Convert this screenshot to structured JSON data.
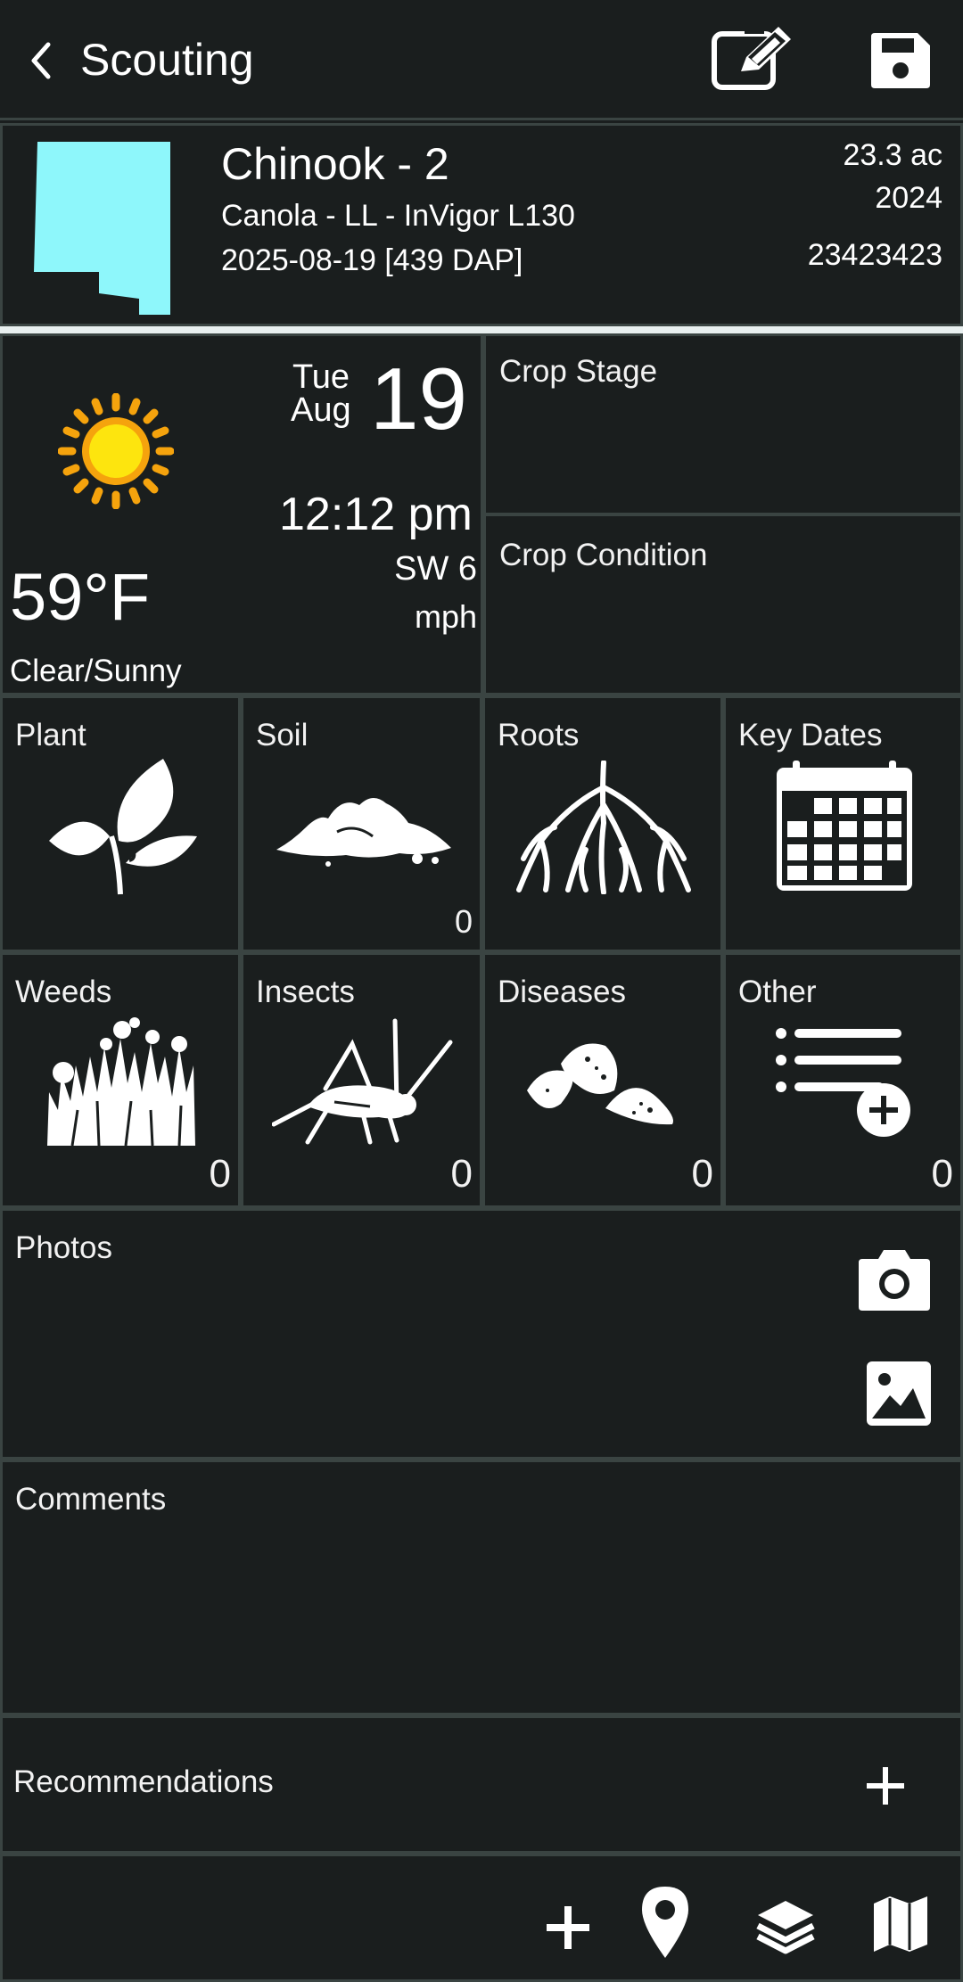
{
  "header": {
    "title": "Scouting",
    "icons": {
      "back": "chevron-left-icon",
      "edit": "edit-icon",
      "save": "save-icon"
    }
  },
  "field": {
    "name": "Chinook - 2",
    "crop": "Canola - LL - InVigor L130",
    "date": "2025-08-19 [439 DAP]",
    "area": "23.3 ac",
    "year": "2024",
    "code": "23423423",
    "shape_color": "#8ef7fb"
  },
  "weather": {
    "weekday": "Tue",
    "month": "Aug",
    "day": "19",
    "time": "12:12 pm",
    "wind_dir": "SW 6",
    "wind_unit": "mph",
    "temp": "59°F",
    "condition": "Clear/Sunny"
  },
  "crop": {
    "stage_label": "Crop Stage",
    "condition_label": "Crop Condition"
  },
  "tiles": {
    "plant": {
      "label": "Plant",
      "count": ""
    },
    "soil": {
      "label": "Soil",
      "count": "0"
    },
    "roots": {
      "label": "Roots",
      "count": ""
    },
    "key_dates": {
      "label": "Key Dates",
      "count": ""
    },
    "weeds": {
      "label": "Weeds",
      "count": "0"
    },
    "insects": {
      "label": "Insects",
      "count": "0"
    },
    "diseases": {
      "label": "Diseases",
      "count": "0"
    },
    "other": {
      "label": "Other",
      "count": "0"
    }
  },
  "photos": {
    "label": "Photos"
  },
  "comments": {
    "label": "Comments"
  },
  "recommendations": {
    "label": "Recommendations"
  },
  "toolbar": {
    "icons": [
      "plus-icon",
      "location-pin-icon",
      "layers-icon",
      "map-icon"
    ]
  },
  "colors": {
    "background": "#1a1e1e",
    "border": "#3a4442",
    "sun": "#fbbf10",
    "sun_rays": "#f5a30d"
  }
}
